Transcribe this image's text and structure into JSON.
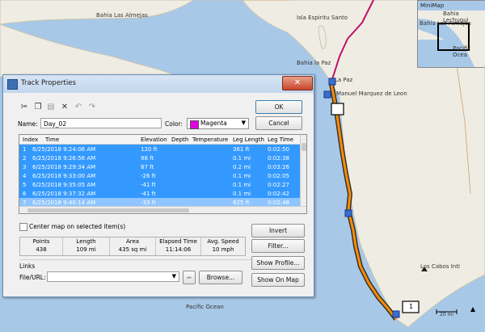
{
  "map": {
    "labels": {
      "bahia_las_almejas": "Bahia Las Almejas",
      "isla_espiritu_santo": "Isla Espiritu Santo",
      "bahia_la_paz": "Bahia la Paz",
      "la_paz": "La Paz",
      "airport_la_paz": "Manuel Marquez de Leon",
      "los_cabos": "Los Cabos Intl",
      "pacific_ocean": "Pacific Ocean",
      "waypoint_label": "1",
      "scale_label": "20 mi"
    },
    "colors": {
      "water": "#a8c8e8",
      "land": "#efede3",
      "track": "#ff8c00",
      "track_outline": "#333333",
      "route": "#c0106a"
    }
  },
  "minimap": {
    "title": "MiniMap",
    "labels": [
      "Bahia Lechugui",
      "Bahia Las Almejas",
      "Pacific Ocea"
    ]
  },
  "dialog": {
    "title": "Track Properties",
    "close_glyph": "✕",
    "toolbar": [
      "cut-icon",
      "copy-icon",
      "paste-icon",
      "delete-icon",
      "undo-icon",
      "redo-icon"
    ],
    "name_label": "Name:",
    "name_value": "Day_02",
    "color_label": "Color:",
    "color_value": "Magenta",
    "color_swatch": "#e000e0",
    "ok": "OK",
    "cancel": "Cancel",
    "grid": {
      "columns": [
        "Index",
        "Time",
        "Elevation",
        "Depth",
        "Temperature",
        "Leg Length",
        "Leg Time"
      ],
      "rows": [
        [
          "1",
          "6/25/2018 9:24:06 AM",
          "120 ft",
          "",
          "",
          "361 ft",
          "0:02:50"
        ],
        [
          "2",
          "6/25/2018 9:26:56 AM",
          "98 ft",
          "",
          "",
          "0.1 mi",
          "0:02:38"
        ],
        [
          "3",
          "6/25/2018 9:29:34 AM",
          "87 ft",
          "",
          "",
          "0.2 mi",
          "0:03:26"
        ],
        [
          "4",
          "6/25/2018 9:33:00 AM",
          "-26 ft",
          "",
          "",
          "0.1 mi",
          "0:02:05"
        ],
        [
          "5",
          "6/25/2018 9:35:05 AM",
          "-41 ft",
          "",
          "",
          "0.1 mi",
          "0:02:27"
        ],
        [
          "6",
          "6/25/2018 9:37:32 AM",
          "-41 ft",
          "",
          "",
          "0.1 mi",
          "0:02:42"
        ],
        [
          "7",
          "6/25/2018 9:40:14 AM",
          "-33 ft",
          "",
          "",
          "625 ft",
          "0:02:48"
        ]
      ]
    },
    "center_map_label": "Center map on selected item(s)",
    "stats": {
      "headers": [
        "Points",
        "Length",
        "Area",
        "Elapsed Time",
        "Avg. Speed"
      ],
      "values": [
        "438",
        "109 mi",
        "435 sq mi",
        "11:14:06",
        "10 mph"
      ]
    },
    "links_label": "Links",
    "file_url_label": "File/URL:",
    "browse": "Browse...",
    "buttons": {
      "invert": "Invert",
      "filter": "Filter...",
      "show_profile": "Show Profile...",
      "show_on_map": "Show On Map"
    }
  }
}
